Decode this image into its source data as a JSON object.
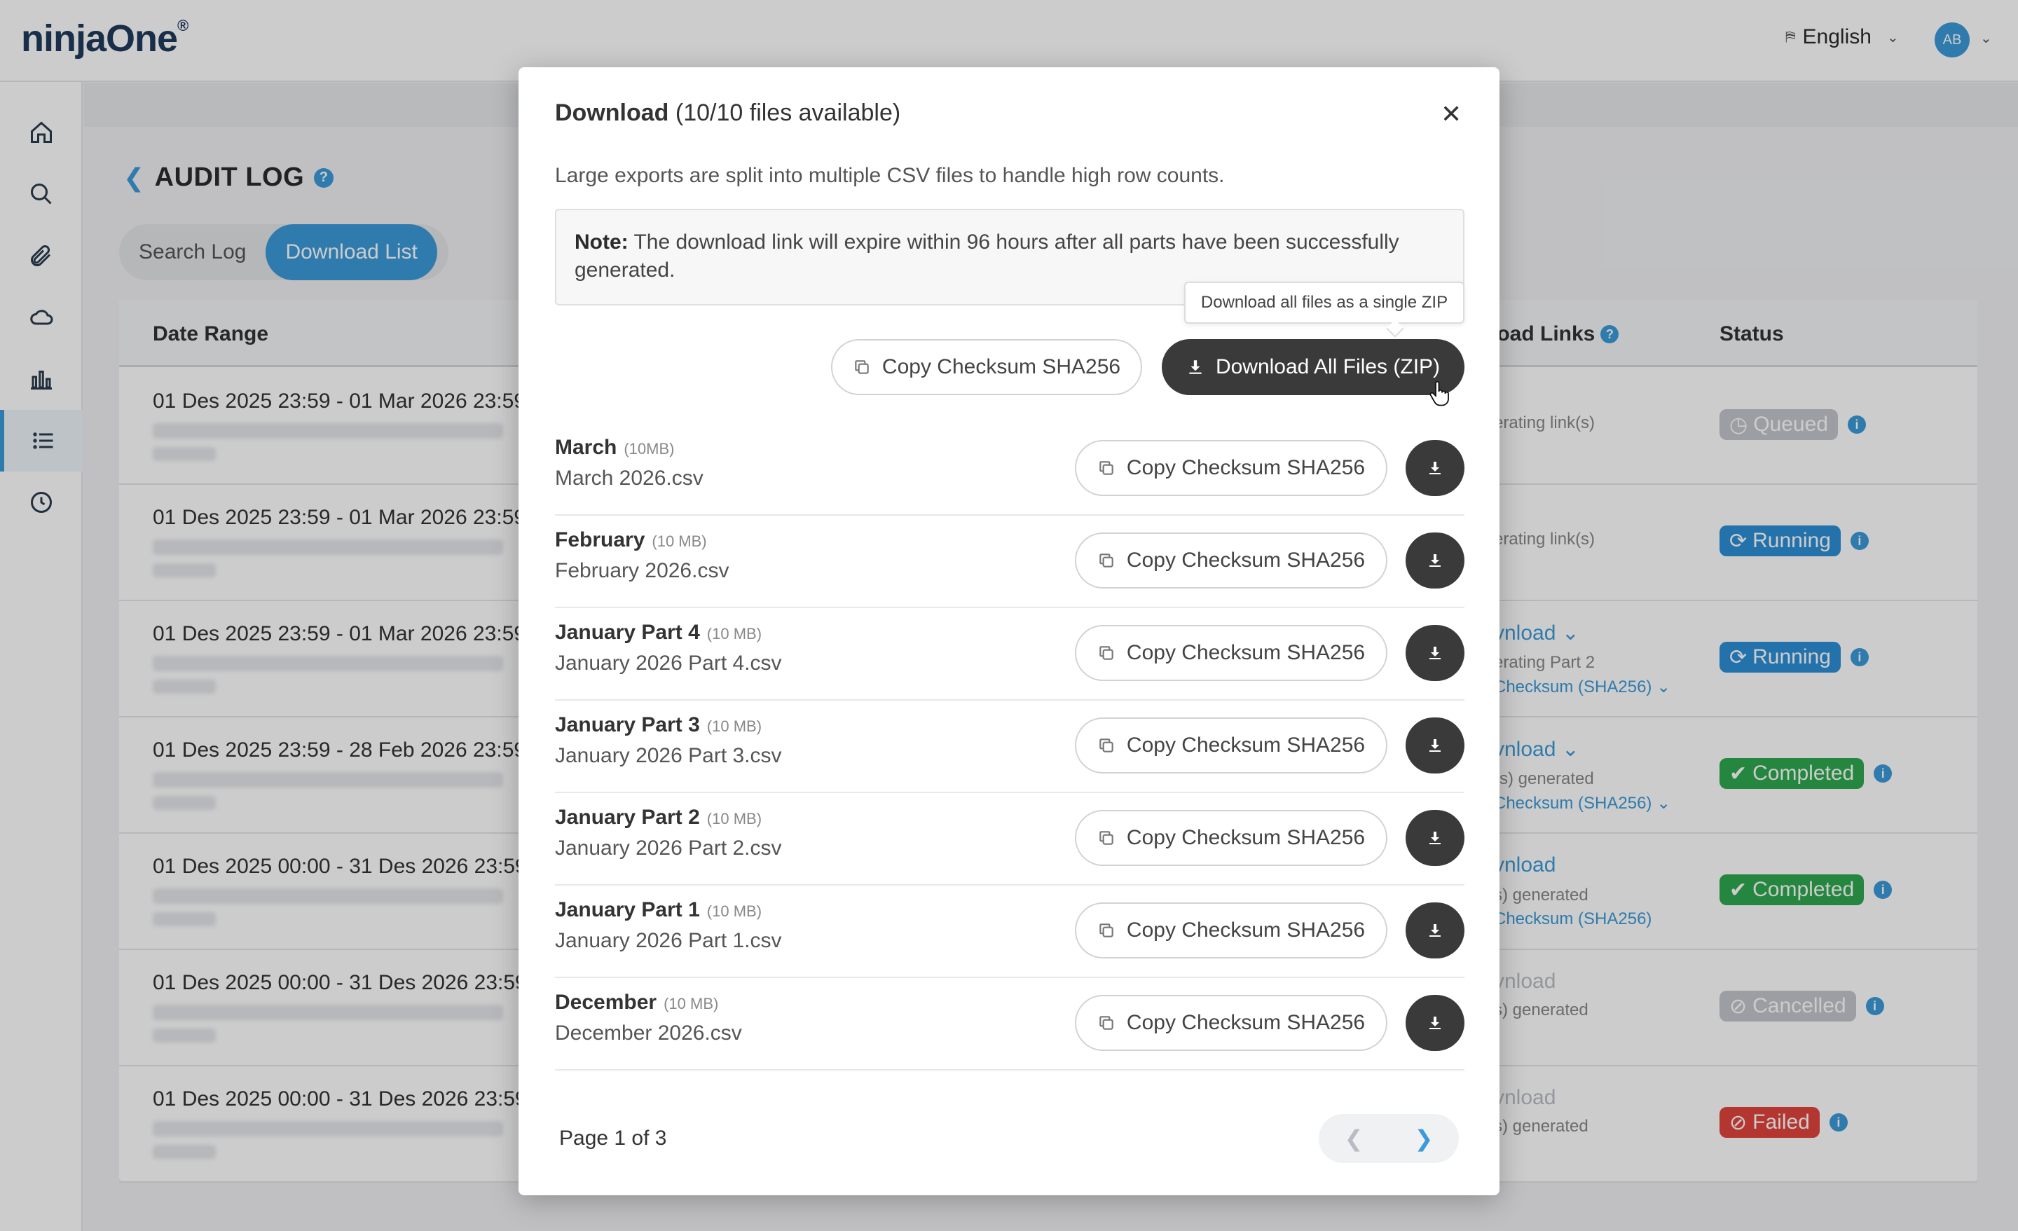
{
  "app": {
    "logo": "ninjaOne",
    "logo_mark": "®",
    "language": "English",
    "avatar_initials": "AB"
  },
  "page": {
    "title": "AUDIT LOG",
    "tabs": [
      {
        "label": "Search Log",
        "active": false
      },
      {
        "label": "Download List",
        "active": true
      }
    ]
  },
  "table": {
    "headers": {
      "date_range": "Date Range",
      "links": "load Links",
      "status": "Status"
    },
    "rows": [
      {
        "date": "01 Des 2025 23:59 - 01 Mar 2026 23:59",
        "lines": [
          {
            "text": "erating link(s)",
            "kind": "txt"
          }
        ],
        "status": "Queued",
        "status_color": "gray"
      },
      {
        "date": "01 Des 2025 23:59 - 01 Mar 2026 23:59",
        "lines": [
          {
            "text": "erating link(s)",
            "kind": "txt"
          }
        ],
        "status": "Running",
        "status_color": "blue"
      },
      {
        "date": "01 Des 2025 23:59 - 01 Mar 2026 23:59",
        "lines": [
          {
            "text": "vnload ⌄",
            "kind": "a"
          },
          {
            "text": "erating Part 2",
            "kind": "txt"
          },
          {
            "text": "Checksum (SHA256) ⌄",
            "kind": "s"
          }
        ],
        "status": "Running",
        "status_color": "blue"
      },
      {
        "date": "01 Des 2025 23:59 - 28 Feb 2026 23:59",
        "lines": [
          {
            "text": "vnload ⌄",
            "kind": "a"
          },
          {
            "text": "(s) generated",
            "kind": "txt"
          },
          {
            "text": "Checksum (SHA256) ⌄",
            "kind": "s"
          }
        ],
        "status": "Completed",
        "status_color": "green"
      },
      {
        "date": "01 Des 2025 00:00 - 31 Des 2026 23:59",
        "lines": [
          {
            "text": "vnload",
            "kind": "a"
          },
          {
            "text": "s) generated",
            "kind": "txt"
          },
          {
            "text": "Checksum (SHA256)",
            "kind": "s"
          }
        ],
        "status": "Completed",
        "status_color": "green"
      },
      {
        "date": "01 Des 2025 00:00 - 31 Des 2026 23:59",
        "lines": [
          {
            "text": "vnload",
            "kind": "a-dim"
          },
          {
            "text": "s) generated",
            "kind": "txt"
          }
        ],
        "status": "Cancelled",
        "status_color": "gray"
      },
      {
        "date": "01 Des 2025 00:00 - 31 Des 2026 23:59",
        "lines": [
          {
            "text": "vnload",
            "kind": "a-dim"
          },
          {
            "text": "s) generated",
            "kind": "txt"
          }
        ],
        "status": "Failed",
        "status_color": "red"
      }
    ]
  },
  "modal": {
    "title_bold": "Download",
    "title_rest": "(10/10 files available)",
    "description": "Large exports are split into multiple CSV files to handle high row counts.",
    "note_label": "Note:",
    "note_text": "The download link will expire within 96 hours after all parts have been successfully generated.",
    "tooltip": "Download all files as a single ZIP",
    "copy_all_label": "Copy Checksum SHA256",
    "download_all_label": "Download All Files (ZIP)",
    "files": [
      {
        "name": "March",
        "size": "(10MB)",
        "file": "March 2026.csv",
        "copy_label": "Copy Checksum SHA256"
      },
      {
        "name": "February",
        "size": "(10 MB)",
        "file": "February 2026.csv",
        "copy_label": "Copy Checksum SHA256"
      },
      {
        "name": "January Part 4",
        "size": "(10 MB)",
        "file": "January 2026 Part 4.csv",
        "copy_label": "Copy Checksum SHA256"
      },
      {
        "name": "January Part 3",
        "size": "(10 MB)",
        "file": "January 2026 Part 3.csv",
        "copy_label": "Copy Checksum SHA256"
      },
      {
        "name": "January Part 2",
        "size": "(10 MB)",
        "file": "January 2026 Part 2.csv",
        "copy_label": "Copy Checksum SHA256"
      },
      {
        "name": "January Part 1",
        "size": "(10 MB)",
        "file": "January 2026 Part 1.csv",
        "copy_label": "Copy Checksum SHA256"
      },
      {
        "name": "December",
        "size": "(10 MB)",
        "file": "December 2026.csv",
        "copy_label": "Copy Checksum SHA256"
      }
    ],
    "pagination": "Page 1 of 3"
  },
  "colors": {
    "accent": "#3b9ad9",
    "dark_button": "#3a3a3a",
    "success": "#2fa84f",
    "danger": "#e0443e"
  }
}
